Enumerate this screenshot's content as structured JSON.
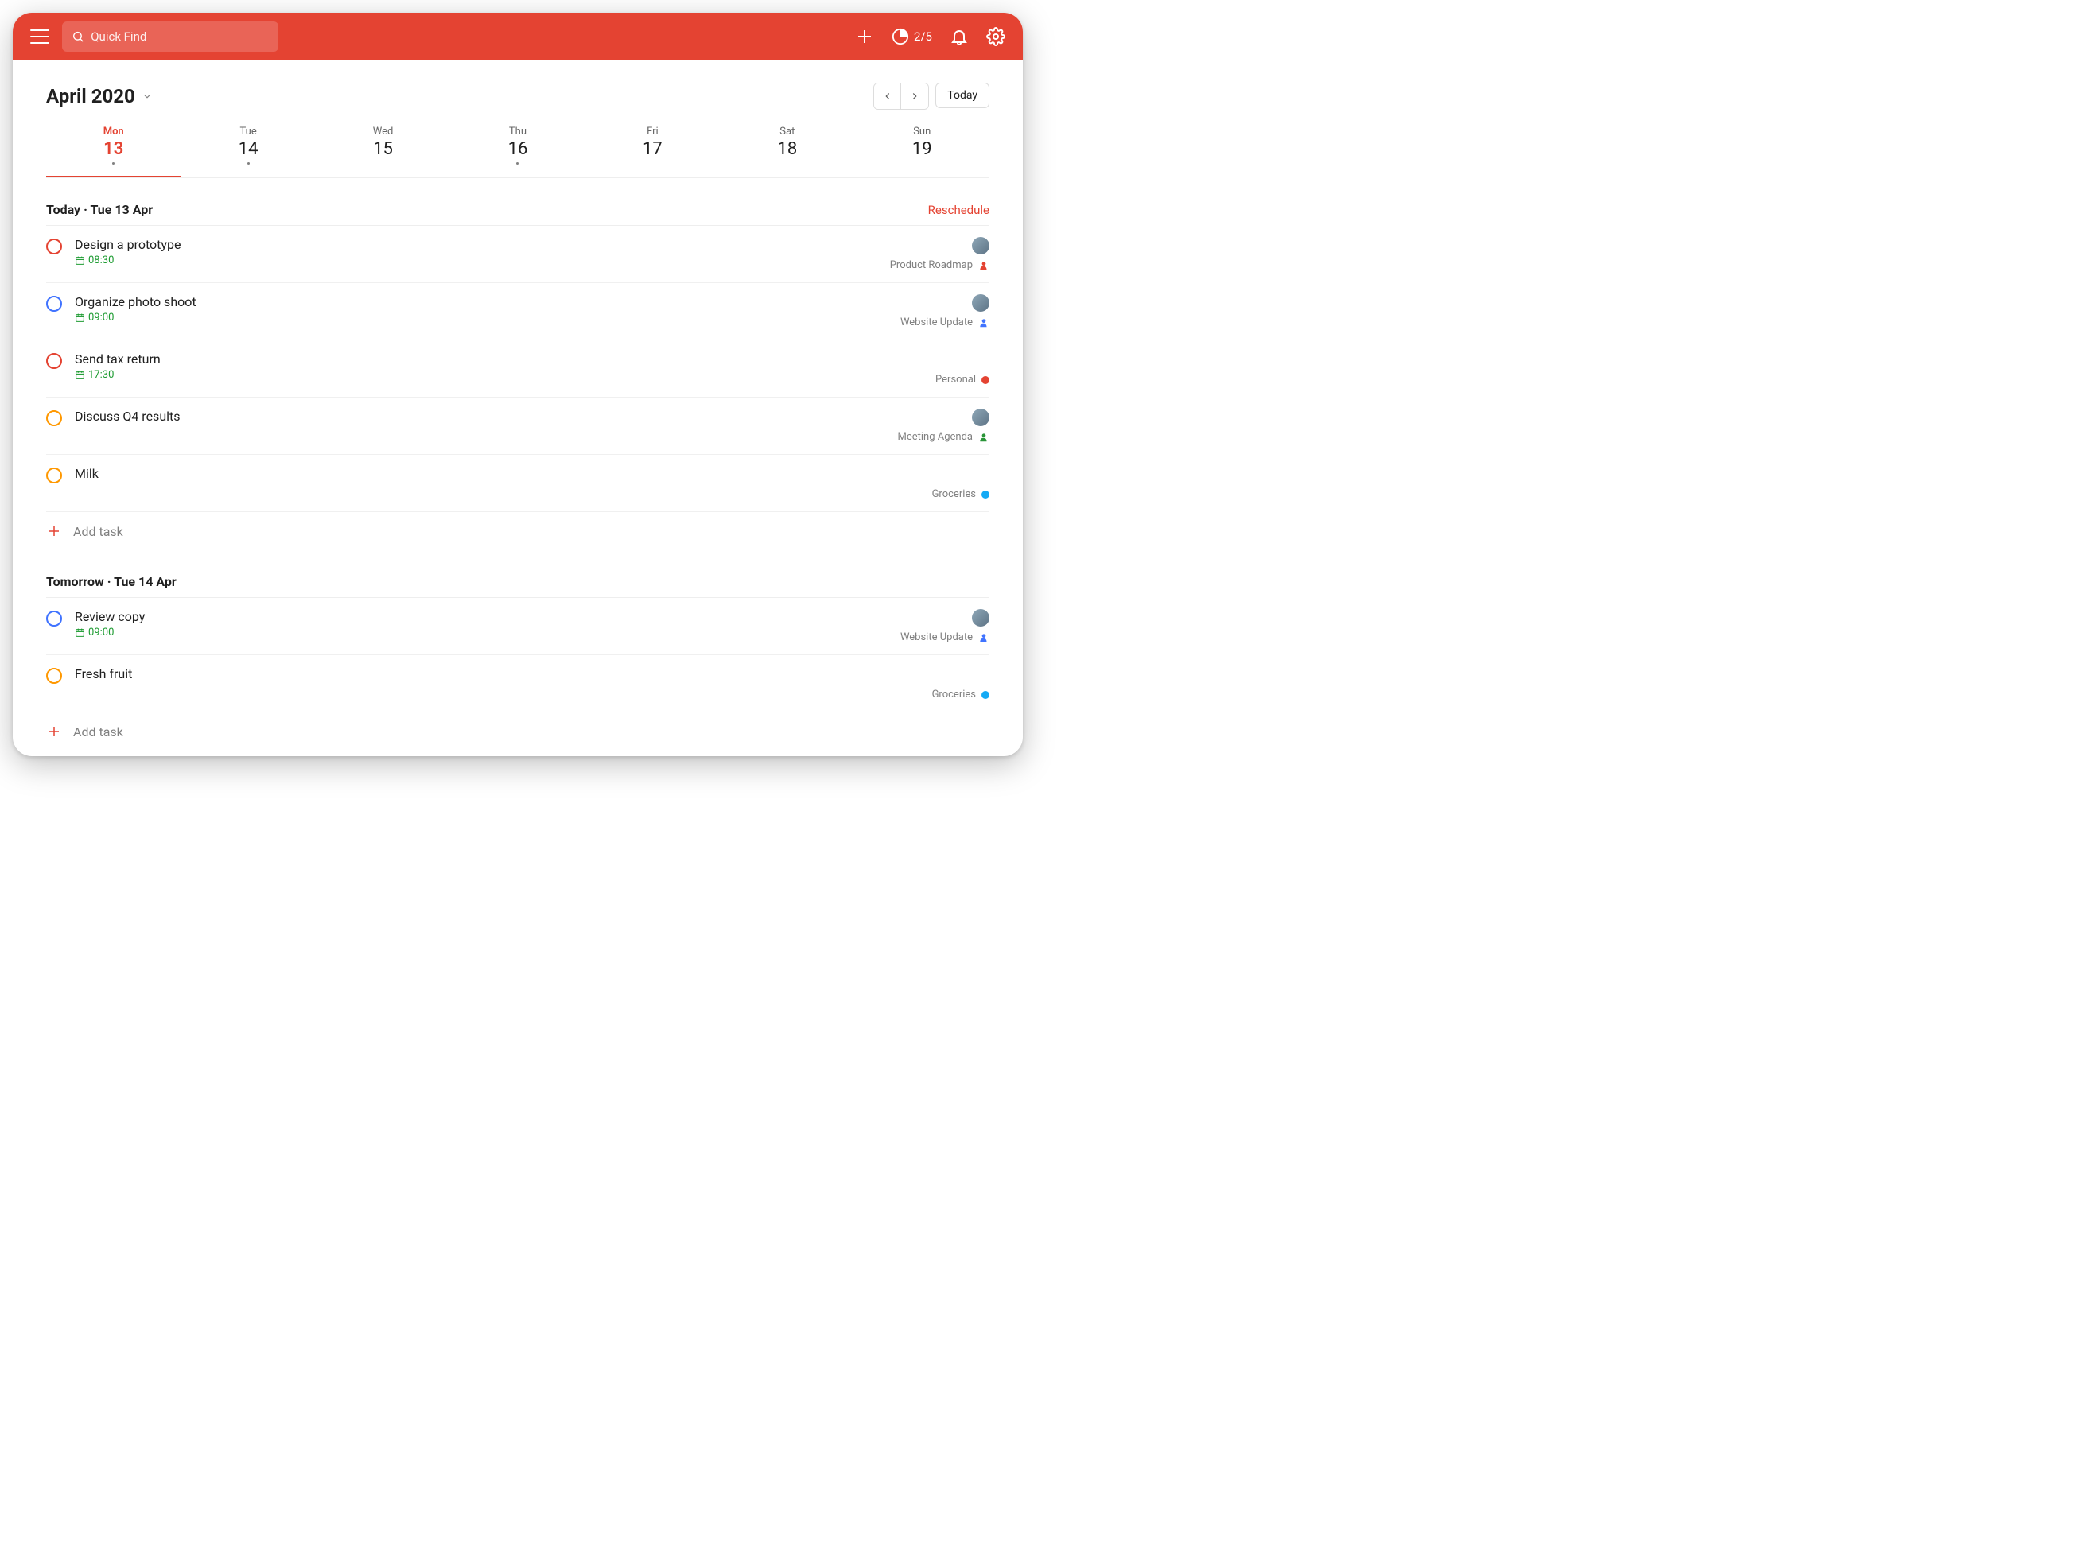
{
  "colors": {
    "accent": "#e44332",
    "p1": "#e44332",
    "p2": "#ff9800",
    "p3": "#4073ff",
    "green": "#299438",
    "blue": "#4073ff",
    "teal": "#14aaf5"
  },
  "topbar": {
    "search_placeholder": "Quick Find",
    "productivity": "2/5"
  },
  "header": {
    "month": "April 2020",
    "today_label": "Today"
  },
  "weekdays": [
    {
      "dow": "Mon",
      "num": "13",
      "active": true,
      "dot": true
    },
    {
      "dow": "Tue",
      "num": "14",
      "active": false,
      "dot": true
    },
    {
      "dow": "Wed",
      "num": "15",
      "active": false,
      "dot": false
    },
    {
      "dow": "Thu",
      "num": "16",
      "active": false,
      "dot": true
    },
    {
      "dow": "Fri",
      "num": "17",
      "active": false,
      "dot": false
    },
    {
      "dow": "Sat",
      "num": "18",
      "active": false,
      "dot": false
    },
    {
      "dow": "Sun",
      "num": "19",
      "active": false,
      "dot": false
    }
  ],
  "sections": [
    {
      "title": "Today · Tue 13 Apr",
      "reschedule": "Reschedule",
      "add_label": "Add task",
      "tasks": [
        {
          "title": "Design a prototype",
          "time": "08:30",
          "checkColor": "#e44332",
          "project": "Product Roadmap",
          "marker": "person",
          "markerColor": "#e44332",
          "avatar": true
        },
        {
          "title": "Organize photo shoot",
          "time": "09:00",
          "checkColor": "#4073ff",
          "project": "Website Update",
          "marker": "person",
          "markerColor": "#4073ff",
          "avatar": true
        },
        {
          "title": "Send tax return",
          "time": "17:30",
          "checkColor": "#e44332",
          "project": "Personal",
          "marker": "dot",
          "markerColor": "#e44332",
          "avatar": false
        },
        {
          "title": "Discuss Q4 results",
          "time": null,
          "checkColor": "#ff9800",
          "project": "Meeting Agenda",
          "marker": "person",
          "markerColor": "#299438",
          "avatar": true
        },
        {
          "title": "Milk",
          "time": null,
          "checkColor": "#ff9800",
          "project": "Groceries",
          "marker": "dot",
          "markerColor": "#14aaf5",
          "avatar": false
        }
      ]
    },
    {
      "title": "Tomorrow · Tue 14 Apr",
      "reschedule": null,
      "add_label": "Add task",
      "tasks": [
        {
          "title": "Review copy",
          "time": "09:00",
          "checkColor": "#4073ff",
          "project": "Website Update",
          "marker": "person",
          "markerColor": "#4073ff",
          "avatar": true
        },
        {
          "title": "Fresh fruit",
          "time": null,
          "checkColor": "#ff9800",
          "project": "Groceries",
          "marker": "dot",
          "markerColor": "#14aaf5",
          "avatar": false
        }
      ]
    }
  ]
}
